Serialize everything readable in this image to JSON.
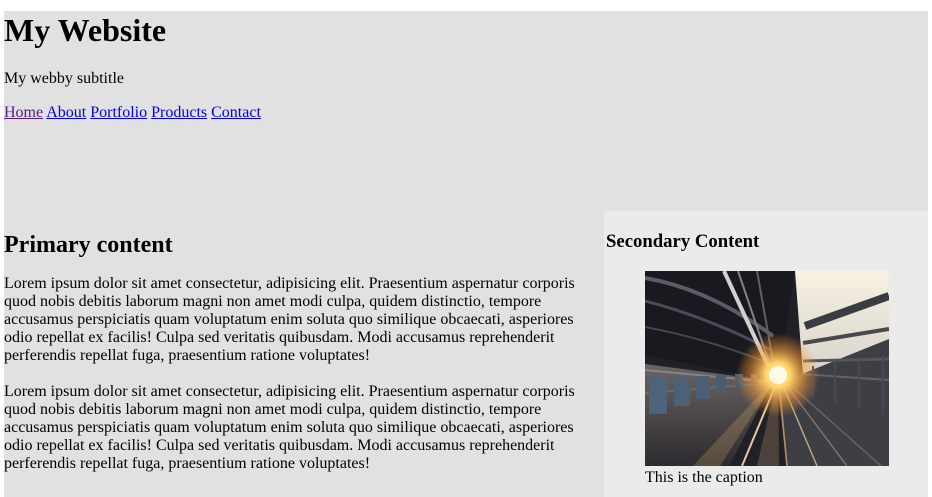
{
  "header": {
    "title": "My Website",
    "subtitle": "My webby subtitle",
    "nav": [
      "Home",
      "About",
      "Portfolio",
      "Products",
      "Contact"
    ]
  },
  "main": {
    "heading": "Primary content",
    "paragraphs": [
      "Lorem ipsum dolor sit amet consectetur, adipisicing elit. Praesentium aspernatur corporis quod nobis debitis laborum magni non amet modi culpa, quidem distinctio, tempore accusamus perspiciatis quam voluptatum enim soluta quo similique obcaecati, asperiores odio repellat ex facilis! Culpa sed veritatis quibusdam. Modi accusamus reprehenderit perferendis repellat fuga, praesentium ratione voluptates!",
      "Lorem ipsum dolor sit amet consectetur, adipisicing elit. Praesentium aspernatur corporis quod nobis debitis laborum magni non amet modi culpa, quidem distinctio, tempore accusamus perspiciatis quam voluptatum enim soluta quo similique obcaecati, asperiores odio repellat ex facilis! Culpa sed veritatis quibusdam. Modi accusamus reprehenderit perferendis repellat fuga, praesentium ratione voluptates!"
    ]
  },
  "aside": {
    "heading": "Secondary Content",
    "caption": "This is the caption",
    "image_icon": "train-station-photo"
  },
  "colors": {
    "header_bg": "#e1e1e1",
    "main_bg": "#e1e1e1",
    "aside_bg": "#ebebeb",
    "link": "#0000ee",
    "visited_link": "#551a8b"
  }
}
